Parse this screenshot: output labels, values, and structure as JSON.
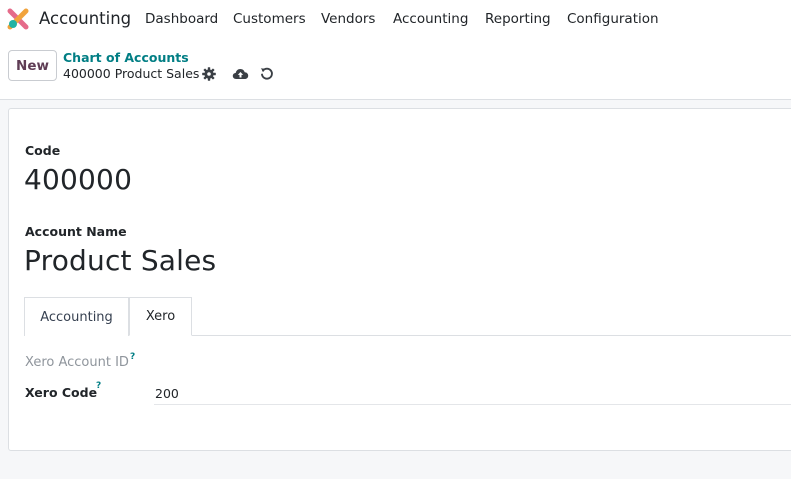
{
  "navbar": {
    "app_name": "Accounting",
    "menu": [
      "Dashboard",
      "Customers",
      "Vendors",
      "Accounting",
      "Reporting",
      "Configuration"
    ]
  },
  "control": {
    "new_label": "New",
    "breadcrumb_parent": "Chart of Accounts",
    "breadcrumb_current": "400000 Product Sales",
    "icons": [
      "gear-icon",
      "cloud-upload-icon",
      "discard-icon"
    ]
  },
  "form": {
    "code_label": "Code",
    "code_value": "400000",
    "name_label": "Account Name",
    "name_value": "Product Sales",
    "tabs": [
      {
        "label": "Accounting",
        "active": false
      },
      {
        "label": "Xero",
        "active": true
      }
    ],
    "xero": {
      "account_id_label": "Xero Account ID",
      "account_id_help": "?",
      "code_label": "Xero Code",
      "code_help": "?",
      "code_value": "200"
    }
  },
  "colors": {
    "brand_purple": "#5f3d55",
    "link_teal": "#017e84",
    "background": "#f6f7f9"
  }
}
